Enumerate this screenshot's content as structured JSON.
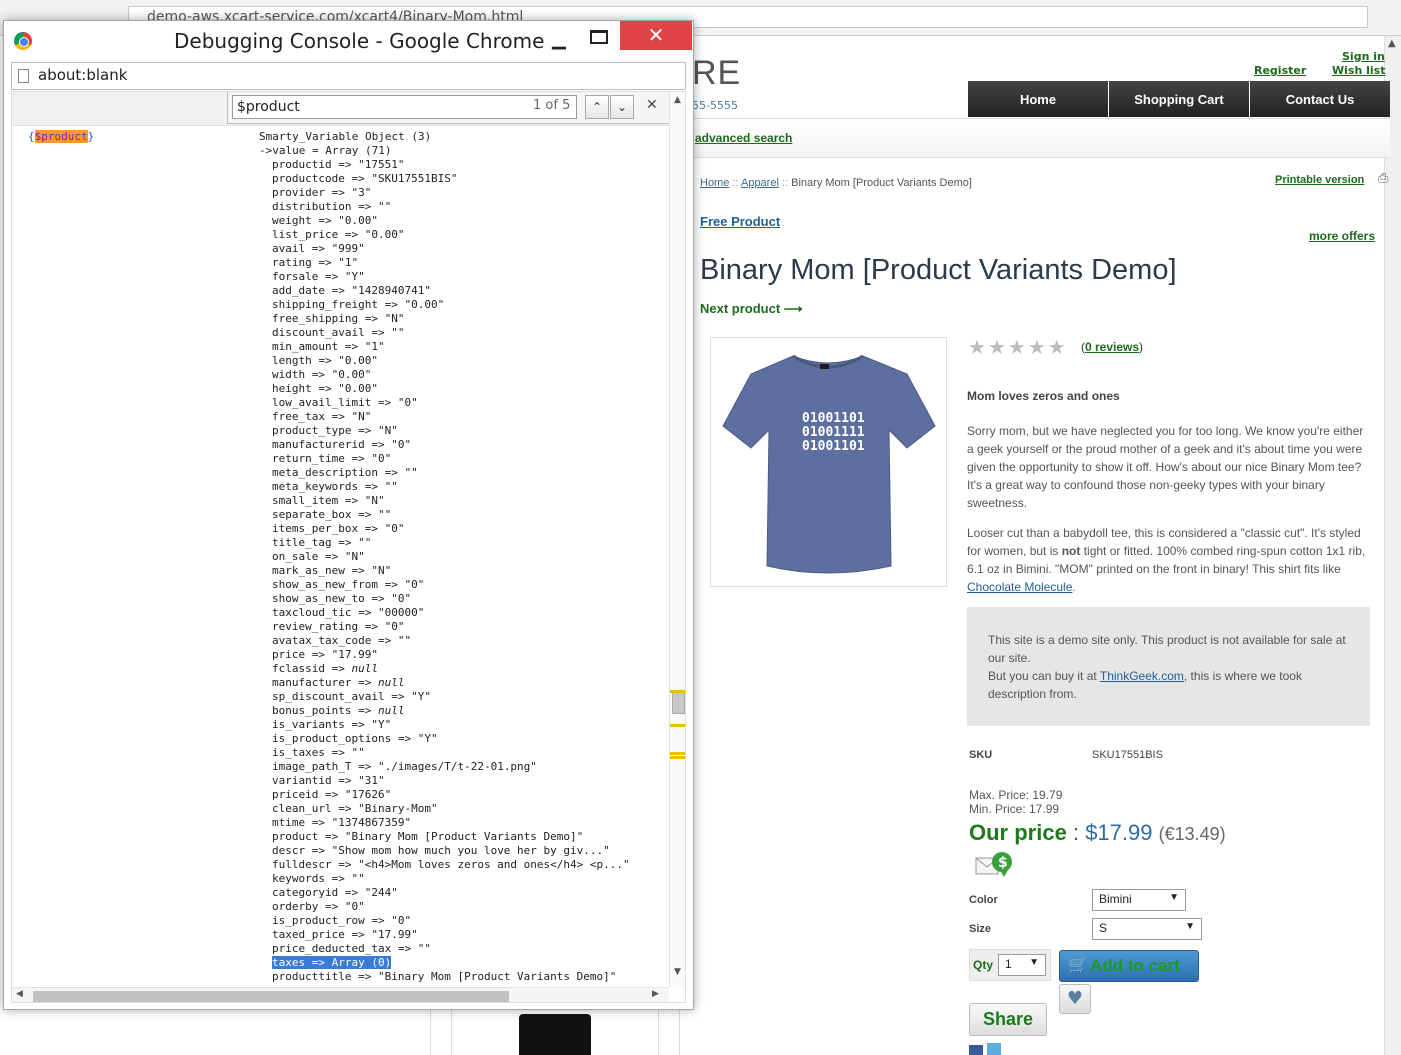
{
  "background_browser": {
    "url": "demo-aws.xcart-service.com/xcart4/Binary-Mom.html"
  },
  "store": {
    "logo_fragment": "RE",
    "phone_fragment": "55-5555",
    "links": {
      "sign_in": "Sign in",
      "register": "Register",
      "wish_list": "Wish list"
    },
    "menu": [
      "Home",
      "Shopping Cart",
      "Contact Us"
    ],
    "advanced_search": "advanced search",
    "breadcrumb": {
      "home": "Home",
      "sep1": "::",
      "apparel": "Apparel",
      "sep2": "::",
      "current": "Binary Mom [Product Variants Demo]"
    },
    "printable_version": "Printable version",
    "free_product": "Free Product",
    "more_offers": "more offers",
    "product_title": "Binary Mom [Product Variants Demo]",
    "next_product": "Next product ⟶",
    "image_text": [
      "01001101",
      "01001111",
      "01001101"
    ],
    "rating": {
      "stars": 5,
      "filled": 0,
      "open": "(",
      "reviews_link": "0 reviews",
      "close": ")"
    },
    "description": {
      "heading": "Mom loves zeros and ones",
      "p1": "Sorry mom, but we have neglected you for too long. We know you're either a geek yourself or the proud mother of a geek and it's about time you were given the opportunity to show it off. How's about our nice Binary Mom tee? It's a great way to confound those non-geeky types with your binary sweetness.",
      "p2_a": "Looser cut than a babydoll tee, this is considered a \"classic cut\". It's styled for women, but is ",
      "p2_bold": "not",
      "p2_b": " tight or fitted. 100% combed ring-spun cotton 1x1 rib, 6.1 oz in Bimini. \"MOM\" printed on the front in binary! This shirt fits like ",
      "p2_link": "Chocolate Molecule",
      "p2_end": "."
    },
    "demo_notice": {
      "line1": "This site is a demo site only. This product is not available for sale at our site.",
      "line2_a": "But you can buy it at ",
      "line2_link": "ThinkGeek.com",
      "line2_b": ", this is where we took description from."
    },
    "sku_label": "SKU",
    "sku_value": "SKU17551BIS",
    "max_price": "Max. Price: 19.79",
    "min_price": "Min. Price: 17.99",
    "our_price_label": "Our price",
    "price_colon": ":",
    "price": "$17.99",
    "price_alt": "(€13.49)",
    "color_label": "Color",
    "color_value": "Bimini",
    "size_label": "Size",
    "size_value": "S",
    "qty_label": "Qty",
    "qty_value": "1",
    "add_to_cart": "Add to cart",
    "share": "Share"
  },
  "debug_window": {
    "title": "Debugging Console - Google Chrome",
    "address": "about:blank",
    "find": {
      "query": "$product",
      "count": "1 of 5"
    },
    "var_open": "{",
    "var_name": "$product",
    "var_close": "}",
    "dump_head_1": "Smarty_Variable Object (3)",
    "dump_head_2": "->value = Array (71)",
    "selected_index": 57,
    "fields": [
      {
        "k": "productid",
        "op": "=>",
        "v": "\"17551\""
      },
      {
        "k": "productcode",
        "op": "=>",
        "v": "\"SKU17551BIS\""
      },
      {
        "k": "provider",
        "op": "=>",
        "v": "\"3\""
      },
      {
        "k": "distribution",
        "op": "=>",
        "v": "\"\""
      },
      {
        "k": "weight",
        "op": "=>",
        "v": "\"0.00\""
      },
      {
        "k": "list_price",
        "op": "=>",
        "v": "\"0.00\""
      },
      {
        "k": "avail",
        "op": "=>",
        "v": "\"999\""
      },
      {
        "k": "rating",
        "op": "=>",
        "v": "\"1\""
      },
      {
        "k": "forsale",
        "op": "=>",
        "v": "\"Y\""
      },
      {
        "k": "add_date",
        "op": "=>",
        "v": "\"1428940741\""
      },
      {
        "k": "shipping_freight",
        "op": "=>",
        "v": "\"0.00\""
      },
      {
        "k": "free_shipping",
        "op": "=>",
        "v": "\"N\""
      },
      {
        "k": "discount_avail",
        "op": "=>",
        "v": "\"\""
      },
      {
        "k": "min_amount",
        "op": "=>",
        "v": "\"1\""
      },
      {
        "k": "length",
        "op": "=>",
        "v": "\"0.00\""
      },
      {
        "k": "width",
        "op": "=>",
        "v": "\"0.00\""
      },
      {
        "k": "height",
        "op": "=>",
        "v": "\"0.00\""
      },
      {
        "k": "low_avail_limit",
        "op": "=>",
        "v": "\"0\""
      },
      {
        "k": "free_tax",
        "op": "=>",
        "v": "\"N\""
      },
      {
        "k": "product_type",
        "op": "=>",
        "v": "\"N\""
      },
      {
        "k": "manufacturerid",
        "op": "=>",
        "v": "\"0\""
      },
      {
        "k": "return_time",
        "op": "=>",
        "v": "\"0\""
      },
      {
        "k": "meta_description",
        "op": "=>",
        "v": "\"\""
      },
      {
        "k": "meta_keywords",
        "op": "=>",
        "v": "\"\""
      },
      {
        "k": "small_item",
        "op": "=>",
        "v": "\"N\""
      },
      {
        "k": "separate_box",
        "op": "=>",
        "v": "\"\""
      },
      {
        "k": "items_per_box",
        "op": "=>",
        "v": "\"0\""
      },
      {
        "k": "title_tag",
        "op": "=>",
        "v": "\"\""
      },
      {
        "k": "on_sale",
        "op": "=>",
        "v": "\"N\""
      },
      {
        "k": "mark_as_new",
        "op": "=>",
        "v": "\"N\""
      },
      {
        "k": "show_as_new_from",
        "op": "=>",
        "v": "\"0\""
      },
      {
        "k": "show_as_new_to",
        "op": "=>",
        "v": "\"0\""
      },
      {
        "k": "taxcloud_tic",
        "op": "=>",
        "v": "\"00000\""
      },
      {
        "k": "review_rating",
        "op": "=>",
        "v": "\"0\""
      },
      {
        "k": "avatax_tax_code",
        "op": "=>",
        "v": "\"\""
      },
      {
        "k": "price",
        "op": "=>",
        "v": "\"17.99\""
      },
      {
        "k": "fclassid",
        "op": "=>",
        "v": "null"
      },
      {
        "k": "manufacturer",
        "op": "=>",
        "v": "null"
      },
      {
        "k": "sp_discount_avail",
        "op": "=>",
        "v": "\"Y\""
      },
      {
        "k": "bonus_points",
        "op": "=>",
        "v": "null"
      },
      {
        "k": "is_variants",
        "op": "=>",
        "v": "\"Y\""
      },
      {
        "k": "is_product_options",
        "op": "=>",
        "v": "\"Y\""
      },
      {
        "k": "is_taxes",
        "op": "=>",
        "v": "\"\""
      },
      {
        "k": "image_path_T",
        "op": "=>",
        "v": "\"./images/T/t-22-01.png\""
      },
      {
        "k": "variantid",
        "op": "=>",
        "v": "\"31\""
      },
      {
        "k": "priceid",
        "op": "=>",
        "v": "\"17626\""
      },
      {
        "k": "clean_url",
        "op": "=>",
        "v": "\"Binary-Mom\""
      },
      {
        "k": "mtime",
        "op": "=>",
        "v": "\"1374867359\""
      },
      {
        "k": "product",
        "op": "=>",
        "v": "\"Binary Mom [Product Variants Demo]\""
      },
      {
        "k": "descr",
        "op": "=>",
        "v": "\"Show mom how much you love her by giv...\""
      },
      {
        "k": "fulldescr",
        "op": "=>",
        "v": "\"<h4>Mom loves zeros and ones</h4> <p...\""
      },
      {
        "k": "keywords",
        "op": "=>",
        "v": "\"\""
      },
      {
        "k": "categoryid",
        "op": "=>",
        "v": "\"244\""
      },
      {
        "k": "orderby",
        "op": "=>",
        "v": "\"0\""
      },
      {
        "k": "is_product_row",
        "op": "=>",
        "v": "\"0\""
      },
      {
        "k": "taxed_price",
        "op": "=>",
        "v": "\"17.99\""
      },
      {
        "k": "price_deducted_tax",
        "op": "=>",
        "v": "\"\""
      },
      {
        "k": "taxes",
        "op": "=>",
        "v": "Array (0)"
      },
      {
        "k": "producttitle",
        "op": "=>",
        "v": "\"Binary Mom [Product Variants Demo]\""
      }
    ]
  },
  "colors": {
    "link_green": "#1c6b1c",
    "price_blue": "#2c6ca8",
    "close_red": "#e04343",
    "find_highlight": "#ff9632",
    "selection_blue": "#3a7bd5"
  }
}
